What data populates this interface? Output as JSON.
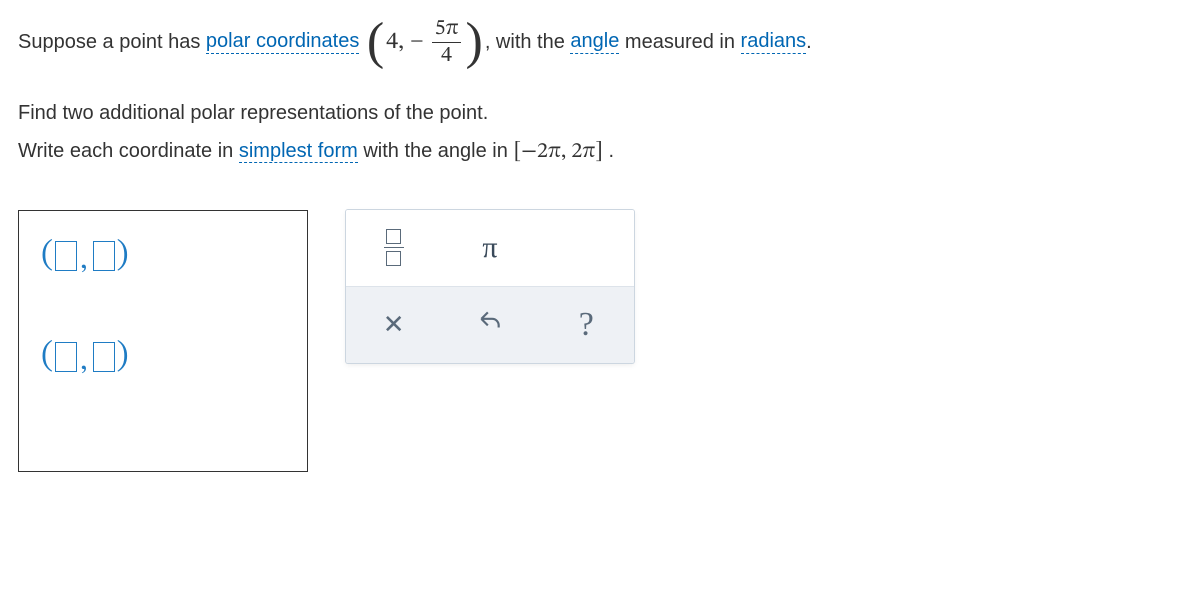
{
  "problem": {
    "intro_a": "Suppose a point has ",
    "link_polar": "polar coordinates",
    "coord_r": "4",
    "coord_frac_num": "5π",
    "coord_frac_den": "4",
    "intro_b": ", with the ",
    "link_angle": "angle",
    "intro_c": " measured in ",
    "link_radians": "radians",
    "intro_d": ".",
    "line2a": "Find two additional polar representations of the point.",
    "line2b_a": "Write each coordinate in ",
    "link_simplest": "simplest form",
    "line2b_b": " with the angle in ",
    "interval": "[−2π,  2π]",
    "line2b_c": "."
  },
  "toolbox": {
    "pi_symbol": "π"
  }
}
